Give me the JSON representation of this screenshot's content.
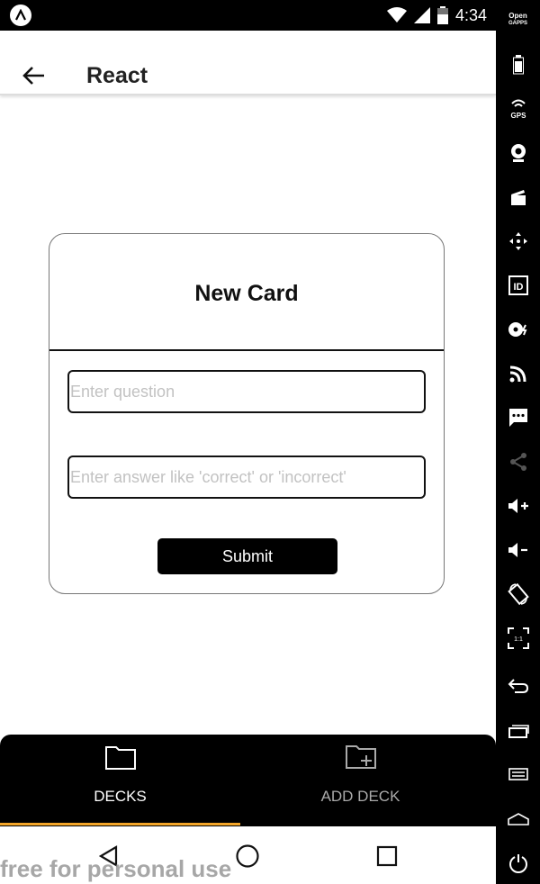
{
  "status_bar": {
    "time": "4:34",
    "icons": [
      "app-badge-icon",
      "wifi-icon",
      "cell-signal-icon",
      "battery-icon"
    ]
  },
  "header": {
    "title": "React",
    "back_icon": "arrow-left-icon"
  },
  "card": {
    "title": "New Card",
    "question_placeholder": "Enter question",
    "answer_placeholder": "Enter answer like 'correct' or 'incorrect'",
    "submit_label": "Submit"
  },
  "tabs": [
    {
      "label": "DECKS",
      "icon": "folder-icon",
      "active": true
    },
    {
      "label": "ADD DECK",
      "icon": "folder-plus-icon",
      "active": false
    }
  ],
  "nav": {
    "buttons": [
      "back-triangle-icon",
      "home-circle-icon",
      "recents-square-icon"
    ],
    "watermark": "free for personal use"
  },
  "side_toolbar": {
    "logo_line1": "Open",
    "logo_line2": "GAPPS",
    "gps_label": "GPS",
    "id_label": "ID",
    "ratio_label": "1:1",
    "items": [
      "battery-icon",
      "gps-icon",
      "camera-icon",
      "clapper-icon",
      "move-icon",
      "id-icon",
      "disk-icon",
      "rss-icon",
      "chat-icon",
      "share-icon",
      "volume-up-icon",
      "volume-down-icon",
      "rotate-icon",
      "scale-icon",
      "back-icon",
      "recents-icon",
      "menu-icon",
      "home-icon",
      "power-icon"
    ]
  },
  "colors": {
    "tab_active_indicator": "#f4a62a",
    "inactive_tab_text": "#aaaaaa",
    "placeholder": "#c2c2c2"
  }
}
